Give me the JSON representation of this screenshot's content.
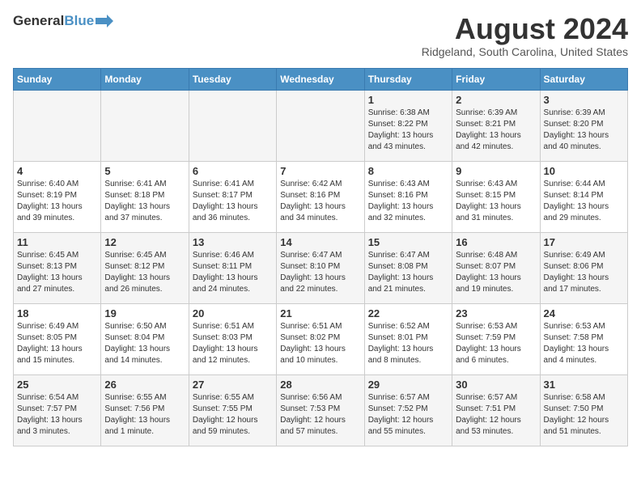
{
  "header": {
    "logo_line1": "General",
    "logo_line2": "Blue",
    "month_title": "August 2024",
    "location": "Ridgeland, South Carolina, United States"
  },
  "days_of_week": [
    "Sunday",
    "Monday",
    "Tuesday",
    "Wednesday",
    "Thursday",
    "Friday",
    "Saturday"
  ],
  "weeks": [
    [
      {
        "day": "",
        "info": ""
      },
      {
        "day": "",
        "info": ""
      },
      {
        "day": "",
        "info": ""
      },
      {
        "day": "",
        "info": ""
      },
      {
        "day": "1",
        "info": "Sunrise: 6:38 AM\nSunset: 8:22 PM\nDaylight: 13 hours\nand 43 minutes."
      },
      {
        "day": "2",
        "info": "Sunrise: 6:39 AM\nSunset: 8:21 PM\nDaylight: 13 hours\nand 42 minutes."
      },
      {
        "day": "3",
        "info": "Sunrise: 6:39 AM\nSunset: 8:20 PM\nDaylight: 13 hours\nand 40 minutes."
      }
    ],
    [
      {
        "day": "4",
        "info": "Sunrise: 6:40 AM\nSunset: 8:19 PM\nDaylight: 13 hours\nand 39 minutes."
      },
      {
        "day": "5",
        "info": "Sunrise: 6:41 AM\nSunset: 8:18 PM\nDaylight: 13 hours\nand 37 minutes."
      },
      {
        "day": "6",
        "info": "Sunrise: 6:41 AM\nSunset: 8:17 PM\nDaylight: 13 hours\nand 36 minutes."
      },
      {
        "day": "7",
        "info": "Sunrise: 6:42 AM\nSunset: 8:16 PM\nDaylight: 13 hours\nand 34 minutes."
      },
      {
        "day": "8",
        "info": "Sunrise: 6:43 AM\nSunset: 8:16 PM\nDaylight: 13 hours\nand 32 minutes."
      },
      {
        "day": "9",
        "info": "Sunrise: 6:43 AM\nSunset: 8:15 PM\nDaylight: 13 hours\nand 31 minutes."
      },
      {
        "day": "10",
        "info": "Sunrise: 6:44 AM\nSunset: 8:14 PM\nDaylight: 13 hours\nand 29 minutes."
      }
    ],
    [
      {
        "day": "11",
        "info": "Sunrise: 6:45 AM\nSunset: 8:13 PM\nDaylight: 13 hours\nand 27 minutes."
      },
      {
        "day": "12",
        "info": "Sunrise: 6:45 AM\nSunset: 8:12 PM\nDaylight: 13 hours\nand 26 minutes."
      },
      {
        "day": "13",
        "info": "Sunrise: 6:46 AM\nSunset: 8:11 PM\nDaylight: 13 hours\nand 24 minutes."
      },
      {
        "day": "14",
        "info": "Sunrise: 6:47 AM\nSunset: 8:10 PM\nDaylight: 13 hours\nand 22 minutes."
      },
      {
        "day": "15",
        "info": "Sunrise: 6:47 AM\nSunset: 8:08 PM\nDaylight: 13 hours\nand 21 minutes."
      },
      {
        "day": "16",
        "info": "Sunrise: 6:48 AM\nSunset: 8:07 PM\nDaylight: 13 hours\nand 19 minutes."
      },
      {
        "day": "17",
        "info": "Sunrise: 6:49 AM\nSunset: 8:06 PM\nDaylight: 13 hours\nand 17 minutes."
      }
    ],
    [
      {
        "day": "18",
        "info": "Sunrise: 6:49 AM\nSunset: 8:05 PM\nDaylight: 13 hours\nand 15 minutes."
      },
      {
        "day": "19",
        "info": "Sunrise: 6:50 AM\nSunset: 8:04 PM\nDaylight: 13 hours\nand 14 minutes."
      },
      {
        "day": "20",
        "info": "Sunrise: 6:51 AM\nSunset: 8:03 PM\nDaylight: 13 hours\nand 12 minutes."
      },
      {
        "day": "21",
        "info": "Sunrise: 6:51 AM\nSunset: 8:02 PM\nDaylight: 13 hours\nand 10 minutes."
      },
      {
        "day": "22",
        "info": "Sunrise: 6:52 AM\nSunset: 8:01 PM\nDaylight: 13 hours\nand 8 minutes."
      },
      {
        "day": "23",
        "info": "Sunrise: 6:53 AM\nSunset: 7:59 PM\nDaylight: 13 hours\nand 6 minutes."
      },
      {
        "day": "24",
        "info": "Sunrise: 6:53 AM\nSunset: 7:58 PM\nDaylight: 13 hours\nand 4 minutes."
      }
    ],
    [
      {
        "day": "25",
        "info": "Sunrise: 6:54 AM\nSunset: 7:57 PM\nDaylight: 13 hours\nand 3 minutes."
      },
      {
        "day": "26",
        "info": "Sunrise: 6:55 AM\nSunset: 7:56 PM\nDaylight: 13 hours\nand 1 minute."
      },
      {
        "day": "27",
        "info": "Sunrise: 6:55 AM\nSunset: 7:55 PM\nDaylight: 12 hours\nand 59 minutes."
      },
      {
        "day": "28",
        "info": "Sunrise: 6:56 AM\nSunset: 7:53 PM\nDaylight: 12 hours\nand 57 minutes."
      },
      {
        "day": "29",
        "info": "Sunrise: 6:57 AM\nSunset: 7:52 PM\nDaylight: 12 hours\nand 55 minutes."
      },
      {
        "day": "30",
        "info": "Sunrise: 6:57 AM\nSunset: 7:51 PM\nDaylight: 12 hours\nand 53 minutes."
      },
      {
        "day": "31",
        "info": "Sunrise: 6:58 AM\nSunset: 7:50 PM\nDaylight: 12 hours\nand 51 minutes."
      }
    ]
  ]
}
